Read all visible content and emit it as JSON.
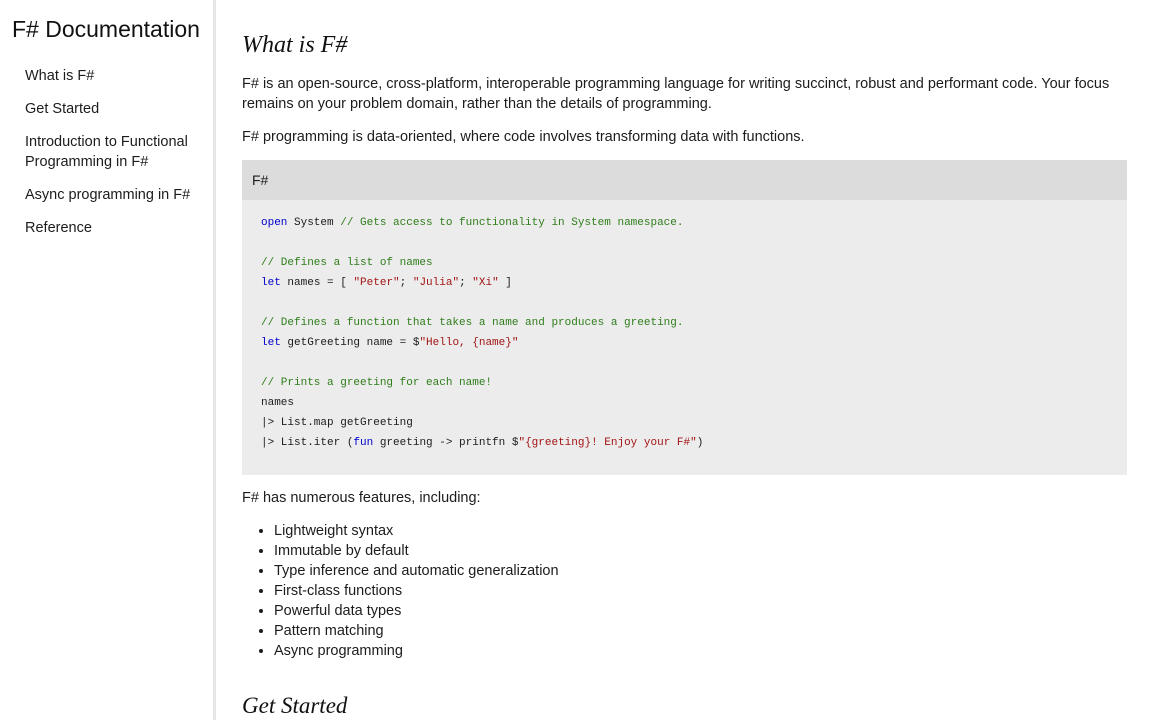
{
  "sidebar": {
    "title": "F# Documentation",
    "items": [
      {
        "label": "What is F#"
      },
      {
        "label": "Get Started"
      },
      {
        "label": "Introduction to Functional Programming in F#"
      },
      {
        "label": "Async programming in F#"
      },
      {
        "label": "Reference"
      }
    ]
  },
  "main": {
    "heading": "What is F#",
    "intro": "F# is an open-source, cross-platform, interoperable programming language for writing succinct, robust and performant code. Your focus remains on your problem domain, rather than the details of programming.",
    "data_oriented": "F# programming is data-oriented, where code involves transforming data with functions.",
    "code": {
      "language": "F#",
      "lines": [
        [
          {
            "t": "open",
            "c": "kw"
          },
          {
            "t": " System ",
            "c": ""
          },
          {
            "t": "// Gets access to functionality in System namespace.",
            "c": "cm"
          }
        ],
        [],
        [
          {
            "t": "// Defines a list of names",
            "c": "cm"
          }
        ],
        [
          {
            "t": "let",
            "c": "kw"
          },
          {
            "t": " names = [ ",
            "c": ""
          },
          {
            "t": "\"Peter\"",
            "c": "st"
          },
          {
            "t": "; ",
            "c": ""
          },
          {
            "t": "\"Julia\"",
            "c": "st"
          },
          {
            "t": "; ",
            "c": ""
          },
          {
            "t": "\"Xi\"",
            "c": "st"
          },
          {
            "t": " ]",
            "c": ""
          }
        ],
        [],
        [
          {
            "t": "// Defines a function that takes a name and produces a greeting.",
            "c": "cm"
          }
        ],
        [
          {
            "t": "let",
            "c": "kw"
          },
          {
            "t": " getGreeting name = $",
            "c": ""
          },
          {
            "t": "\"Hello, ",
            "c": "st"
          },
          {
            "t": "{name}",
            "c": "st"
          },
          {
            "t": "\"",
            "c": "st"
          }
        ],
        [],
        [
          {
            "t": "// Prints a greeting for each name!",
            "c": "cm"
          }
        ],
        [
          {
            "t": "names",
            "c": ""
          }
        ],
        [
          {
            "t": "|> List.map getGreeting",
            "c": ""
          }
        ],
        [
          {
            "t": "|> List.iter (",
            "c": ""
          },
          {
            "t": "fun",
            "c": "kw"
          },
          {
            "t": " greeting -> printfn $",
            "c": ""
          },
          {
            "t": "\"{greeting}! Enjoy your F#\"",
            "c": "st"
          },
          {
            "t": ")",
            "c": ""
          }
        ]
      ]
    },
    "features_intro": "F# has numerous features, including:",
    "features": [
      "Lightweight syntax",
      "Immutable by default",
      "Type inference and automatic generalization",
      "First-class functions",
      "Powerful data types",
      "Pattern matching",
      "Async programming"
    ],
    "next_heading": "Get Started"
  }
}
